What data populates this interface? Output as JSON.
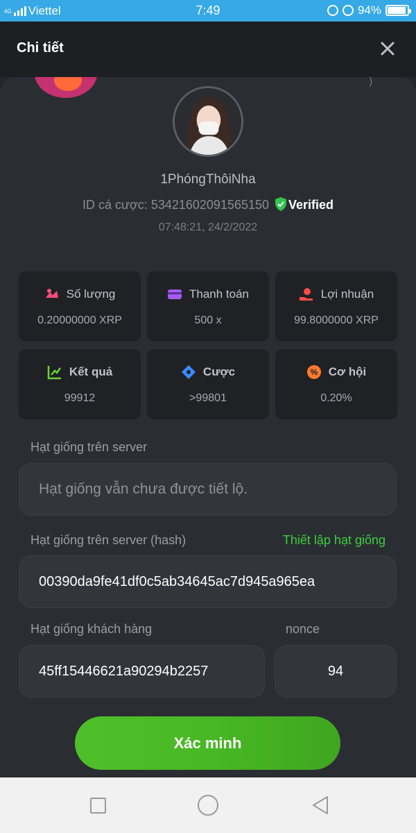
{
  "status_bar": {
    "network_label": "4G",
    "carrier": "Viettel",
    "time": "7:49",
    "battery_percent": "94%",
    "battery_level": 0.94
  },
  "header": {
    "title": "Chi tiết"
  },
  "profile": {
    "username": "1PhóngThôiNha",
    "bet_id_label": "ID cá cược:",
    "bet_id": "53421602091565150",
    "verified_label": "Verified",
    "timestamp": "07:48:21, 24/2/2022"
  },
  "stats": [
    {
      "label": "Số lượng",
      "value": "0.20000000 XRP",
      "icon": "coins-icon",
      "color": "#ff4d79"
    },
    {
      "label": "Thanh toán",
      "value": "500 x",
      "icon": "card-icon",
      "color": "#a45cf0"
    },
    {
      "label": "Lợi nhuận",
      "value": "99.8000000 XRP",
      "icon": "profit-hand-icon",
      "color": "#ff4a4a"
    },
    {
      "label": "Kết quả",
      "value": "99912",
      "icon": "result-chart-icon",
      "color": "#6fd13a"
    },
    {
      "label": "Cược",
      "value": ">99801",
      "icon": "bet-tag-icon",
      "color": "#3a8cff"
    },
    {
      "label": "Cơ hội",
      "value": "0.20%",
      "icon": "percent-icon",
      "color": "#ff7a2e"
    }
  ],
  "server_seed": {
    "label": "Hạt giống trên server",
    "placeholder": "Hạt giống vẫn chưa được tiết lộ."
  },
  "server_seed_hash": {
    "label": "Hạt giống trên server (hash)",
    "link": "Thiết lập hạt giống",
    "value": "00390da9fe41df0c5ab34645ac7d945a965ea"
  },
  "client_seed": {
    "label": "Hạt giống khách hàng",
    "value": "45ff15446621a90294b2257"
  },
  "nonce": {
    "label": "nonce",
    "value": "94"
  },
  "verify_button": "Xác minh"
}
